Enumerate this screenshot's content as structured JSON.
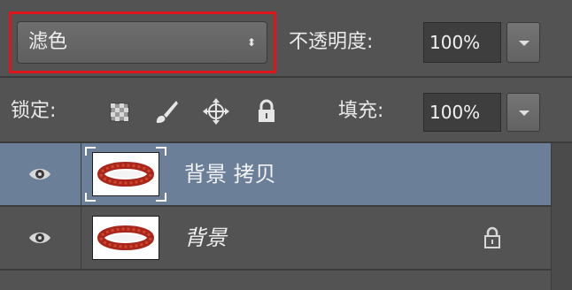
{
  "blend": {
    "mode": "滤色",
    "arrows": "⬍"
  },
  "opacity": {
    "label": "不透明度:",
    "value": "100%"
  },
  "lock": {
    "label": "锁定:"
  },
  "fill": {
    "label": "填充:",
    "value": "100%"
  },
  "layers": [
    {
      "name": "背景 拷贝",
      "selected": true
    },
    {
      "name": "背景",
      "locked": true
    }
  ],
  "colors": {
    "highlight": "#e0141b",
    "selected_layer": "#6c7f99",
    "panel": "#535353"
  }
}
